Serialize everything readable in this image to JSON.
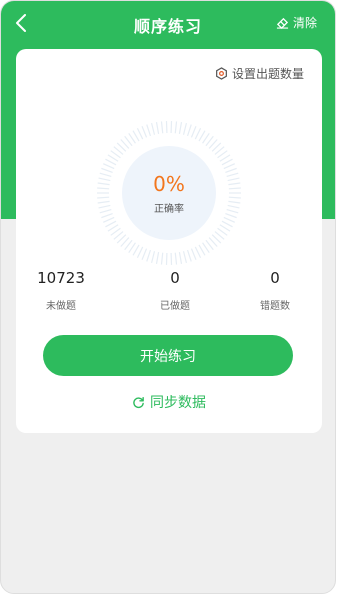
{
  "header": {
    "title": "顺序练习",
    "clear_label": "清除"
  },
  "settings": {
    "label": "设置出题数量"
  },
  "progress": {
    "accuracy": "0%",
    "accuracy_label": "正确率"
  },
  "stats": [
    {
      "value": "10723",
      "label": "未做题"
    },
    {
      "value": "0",
      "label": "已做题"
    },
    {
      "value": "0",
      "label": "错题数"
    }
  ],
  "actions": {
    "start_label": "开始练习",
    "sync_label": "同步数据"
  },
  "colors": {
    "accent": "#2dbb5d",
    "rate": "#f2761d"
  }
}
